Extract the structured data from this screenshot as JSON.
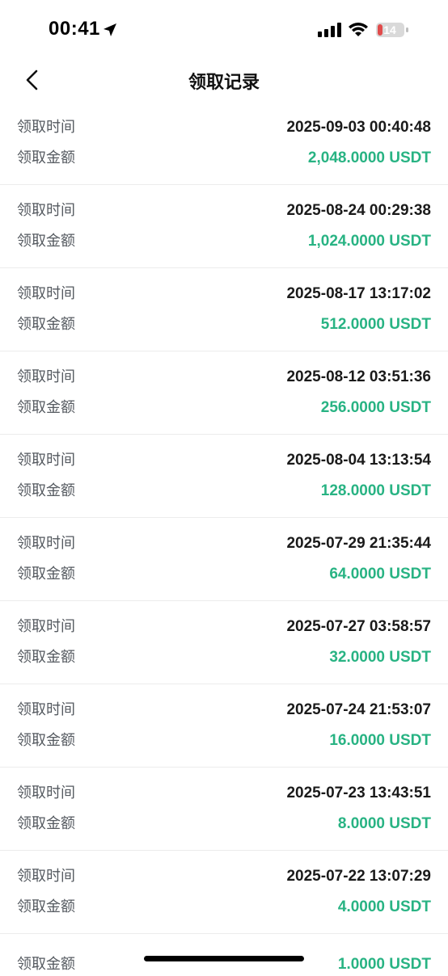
{
  "status_bar": {
    "time": "00:41",
    "battery": "14"
  },
  "header": {
    "title": "领取记录"
  },
  "labels": {
    "time": "领取时间",
    "amount": "领取金额"
  },
  "colors": {
    "amount": "#28b383",
    "text": "#1a1a1a",
    "label": "#555a60"
  },
  "records": [
    {
      "time": "2025-09-03 00:40:48",
      "amount": "2,048.0000 USDT"
    },
    {
      "time": "2025-08-24 00:29:38",
      "amount": "1,024.0000 USDT"
    },
    {
      "time": "2025-08-17 13:17:02",
      "amount": "512.0000 USDT"
    },
    {
      "time": "2025-08-12 03:51:36",
      "amount": "256.0000 USDT"
    },
    {
      "time": "2025-08-04 13:13:54",
      "amount": "128.0000 USDT"
    },
    {
      "time": "2025-07-29 21:35:44",
      "amount": "64.0000 USDT"
    },
    {
      "time": "2025-07-27 03:58:57",
      "amount": "32.0000 USDT"
    },
    {
      "time": "2025-07-24 21:53:07",
      "amount": "16.0000 USDT"
    },
    {
      "time": "2025-07-23 13:43:51",
      "amount": "8.0000 USDT"
    },
    {
      "time": "2025-07-22 13:07:29",
      "amount": "4.0000 USDT"
    }
  ],
  "partial_record": {
    "amount": "1.0000 USDT"
  }
}
